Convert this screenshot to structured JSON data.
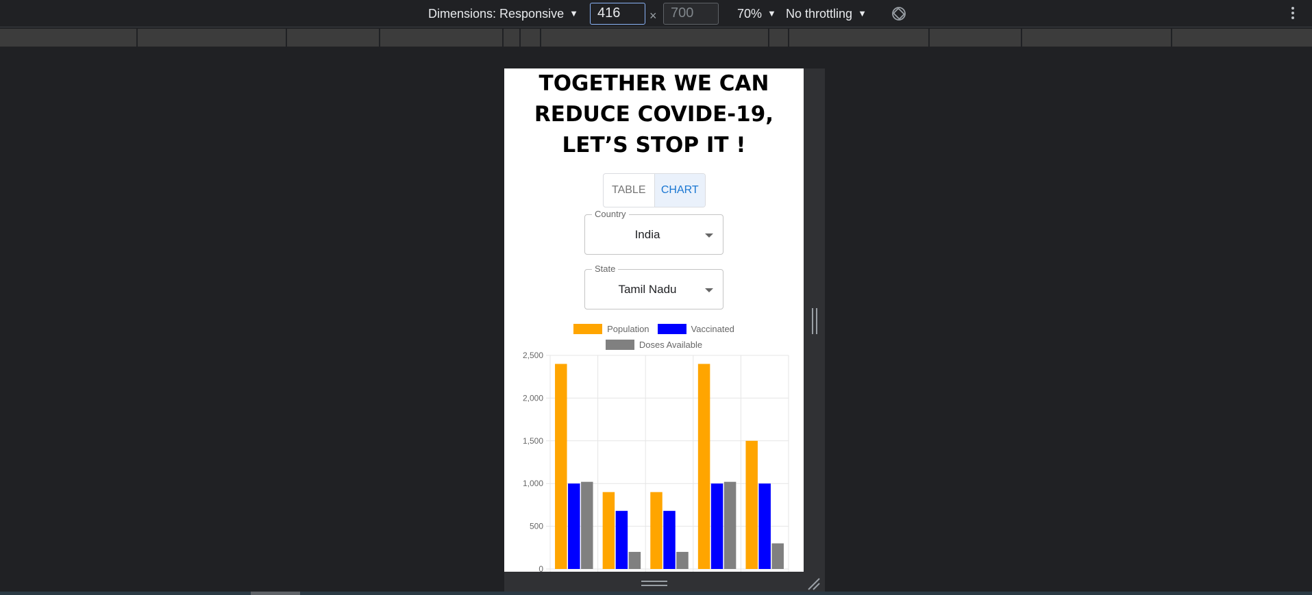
{
  "devtools": {
    "dimensions_label": "Dimensions: Responsive",
    "width_value": "416",
    "height_value": "700",
    "times": "×",
    "zoom": "70%",
    "throttling": "No throttling"
  },
  "page": {
    "headline": "TOGETHER WE CAN REDUCE COVIDE-19, LET’S STOP IT !",
    "toggle": {
      "table_label": "TABLE",
      "chart_label": "CHART",
      "selected": "CHART"
    },
    "country": {
      "label": "Country",
      "value": "India"
    },
    "state": {
      "label": "State",
      "value": "Tamil Nadu"
    }
  },
  "chart_data": {
    "type": "bar",
    "categories": [
      "",
      "",
      "",
      "",
      ""
    ],
    "series": [
      {
        "name": "Population",
        "color": "#FFA500",
        "values": [
          2400,
          900,
          900,
          2400,
          1500
        ]
      },
      {
        "name": "Vaccinated",
        "color": "#0000FF",
        "values": [
          1000,
          680,
          680,
          1000,
          1000
        ]
      },
      {
        "name": "Doses Available",
        "color": "#808080",
        "values": [
          1020,
          200,
          200,
          1020,
          300
        ]
      }
    ],
    "yticks": [
      "0",
      "500",
      "1,000",
      "1,500",
      "2,000",
      "2,500"
    ],
    "ylim": [
      0,
      2500
    ],
    "grid": true,
    "legend_position": "top"
  }
}
